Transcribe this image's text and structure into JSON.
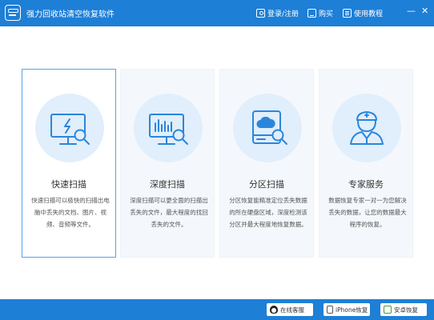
{
  "window": {
    "title": "强力回收站清空恢复软件",
    "minimize_glyph": "—",
    "close_glyph": "✕"
  },
  "toolbar": {
    "login_label": "登录/注册",
    "buy_label": "购买",
    "help_label": "使用教程"
  },
  "cards": [
    {
      "title": "快速扫描",
      "icon": "monitor-lightning-magnifier-icon",
      "description": "快速扫描可以极快的扫描出电脑中丢失的文档、图片、视频、音频等文件。",
      "selected": true
    },
    {
      "title": "深度扫描",
      "icon": "monitor-barcode-magnifier-icon",
      "description": "深度扫描可以更全面的扫描出丢失的文件，最大程度的找回丢失的文件。",
      "selected": false
    },
    {
      "title": "分区扫描",
      "icon": "disk-cloud-magnifier-icon",
      "description": "分区恢复能精准定位丢失数据的所在硬盘区域，深度检测该分区并最大程度地恢复数据。",
      "selected": false
    },
    {
      "title": "专家服务",
      "icon": "doctor-expert-icon",
      "description": "数据恢复专家一对一为您解决丢失的数据，让您的数据最大程序的恢复。",
      "selected": false
    }
  ],
  "bottom": {
    "online_support_label": "在线客服",
    "iphone_recovery_label": "iPhone恢复",
    "recover_label": "安卓恢复"
  },
  "colors": {
    "accent": "#1e7fd6",
    "icon_stroke": "#2a86dc",
    "icon_circle": "#e1eefb",
    "card_bg": "#f4f8fc",
    "selected_border": "#5aa0e6"
  }
}
